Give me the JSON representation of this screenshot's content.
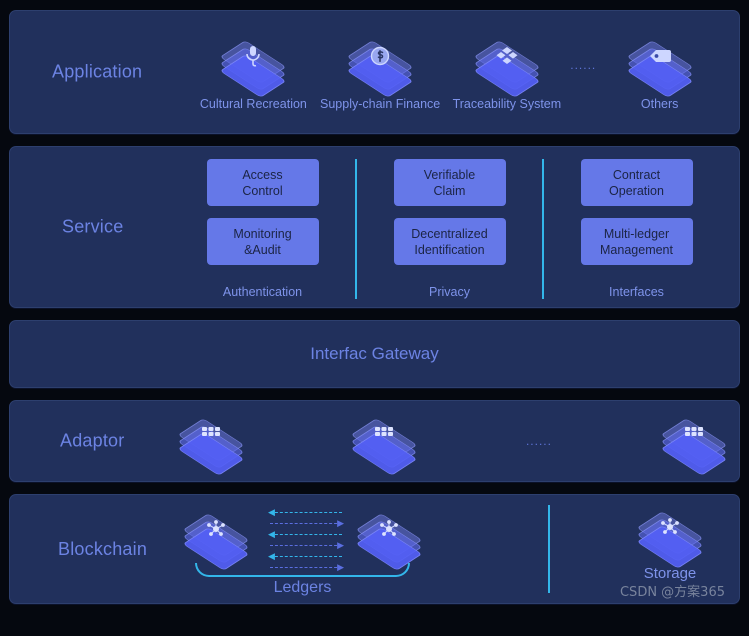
{
  "layers": {
    "application": {
      "label": "Application",
      "items": [
        {
          "caption": "Cultural Recreation",
          "icon": "microphone-icon"
        },
        {
          "caption": "Supply-chain Finance",
          "icon": "currency-coin-icon"
        },
        {
          "caption": "Traceability System",
          "icon": "boxes-icon"
        },
        {
          "caption": "Others",
          "icon": "tag-icon"
        }
      ],
      "ellipsis": "......"
    },
    "service": {
      "label": "Service",
      "groups": [
        {
          "caption": "Authentication",
          "boxes": [
            {
              "line1": "Access",
              "line2": "Control"
            },
            {
              "line1": "Monitoring",
              "line2": "&Audit"
            }
          ]
        },
        {
          "caption": "Privacy",
          "boxes": [
            {
              "line1": "Verifiable",
              "line2": "Claim"
            },
            {
              "line1": "Decentralized",
              "line2": "Identification"
            }
          ]
        },
        {
          "caption": "Interfaces",
          "boxes": [
            {
              "line1": "Contract",
              "line2": "Operation"
            },
            {
              "line1": "Multi-ledger",
              "line2": "Management"
            }
          ]
        }
      ]
    },
    "gateway": {
      "title": "Interfac Gateway"
    },
    "adaptor": {
      "label": "Adaptor",
      "nodes": [
        {
          "icon": "adaptor-grid-icon"
        },
        {
          "icon": "adaptor-grid-icon"
        },
        {
          "icon": "adaptor-grid-icon"
        }
      ],
      "ellipsis": "......"
    },
    "blockchain": {
      "label": "Blockchain",
      "ledgers_label": "Ledgers",
      "nodes": [
        {
          "icon": "network-nodes-icon"
        },
        {
          "icon": "network-nodes-icon"
        }
      ],
      "arrows": [
        {
          "direction": "left",
          "head": "◀"
        },
        {
          "direction": "right",
          "head": "▶"
        },
        {
          "direction": "left",
          "head": "◀"
        },
        {
          "direction": "right",
          "head": "▶"
        },
        {
          "direction": "left",
          "head": "◀"
        },
        {
          "direction": "right",
          "head": "▶"
        }
      ],
      "storage": {
        "label": "Storage",
        "icon": "network-nodes-icon"
      }
    }
  },
  "watermark": "CSDN @方案365",
  "colors": {
    "page_background": "#05080f",
    "panel_background": "#21305c",
    "panel_border": "#2d3f6e",
    "label_text": "#6c83e3",
    "caption_text": "#7e93ea",
    "service_box": "#6578e8",
    "service_box_text": "#1b2444",
    "divider_cyan": "#33b6ea",
    "arrow_blue": "#5a6ee0",
    "icon_fill": "#545ff5"
  }
}
